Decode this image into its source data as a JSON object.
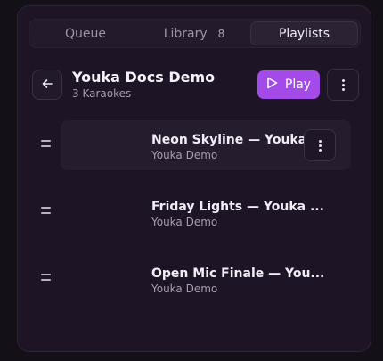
{
  "tabs": [
    {
      "label": "Queue",
      "count": ""
    },
    {
      "label": "Library",
      "count": "8"
    },
    {
      "label": "Playlists",
      "count": ""
    }
  ],
  "active_tab": "Playlists",
  "playlist": {
    "title": "Youka Docs Demo",
    "subtitle": "3 Karaokes",
    "play_label": "Play"
  },
  "items": [
    {
      "title": "Neon Skyline — Youka ...",
      "artist": "Youka Demo"
    },
    {
      "title": "Friday Lights — Youka ...",
      "artist": "Youka Demo"
    },
    {
      "title": "Open Mic Finale — You...",
      "artist": "Youka Demo"
    }
  ],
  "colors": {
    "accent": "#a34ae8",
    "panel": "#1d1425",
    "background": "#141018"
  },
  "icons": {
    "back": "arrow-left-icon",
    "play": "play-icon",
    "more": "more-vertical-icon",
    "drag": "drag-handle-icon"
  }
}
